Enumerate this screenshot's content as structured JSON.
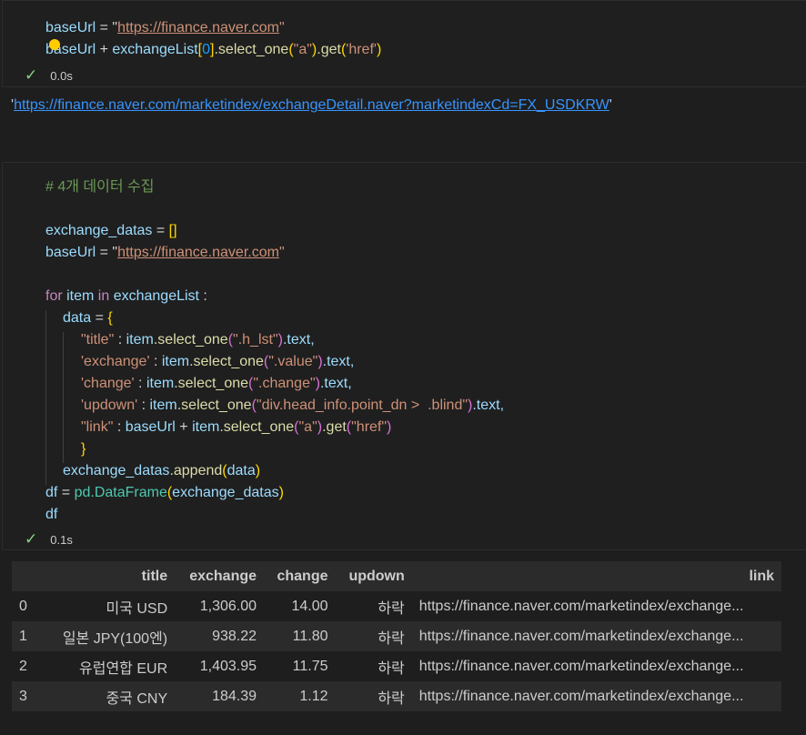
{
  "cell1": {
    "line1": {
      "var": "baseUrl",
      "op": " = \"",
      "url": "https://finance.naver.com",
      "close": "\""
    },
    "line2": {
      "var": "baseUrl",
      "op": " + ",
      "list": "exchangeList",
      "br1": "[",
      "idx": "0",
      "br2": "]",
      "call1": ".select_one",
      "p1": "(",
      "arg1": "\"a\"",
      "p2": ")",
      "call2": ".get",
      "p3": "(",
      "arg2": "'href'",
      "p4": ")"
    },
    "status_time": "0.0s"
  },
  "output1": {
    "quote_open": "'",
    "url": "https://finance.naver.com/marketindex/exchangeDetail.naver?marketindexCd=FX_USDKRW",
    "quote_close": "'"
  },
  "cell2": {
    "comment": "# 4개 데이터 수집",
    "l_datas": "exchange_datas",
    "l_datas_eq": " = ",
    "l_datas_val": "[]",
    "l_base": "baseUrl",
    "l_base_eq": " = \"",
    "l_base_url": "https://finance.naver.com",
    "l_base_close": "\"",
    "for_kw": "for",
    "for_item": " item ",
    "in_kw": "in",
    "for_list": " exchangeList",
    "for_colon": " :",
    "data_var": "data",
    "data_eq": " = ",
    "data_brace": "{",
    "rows": [
      {
        "key": "\"title\"",
        "sep": " : ",
        "obj": "item",
        "fn": ".select_one",
        "p1": "(",
        "arg": "\".h_lst\"",
        "p2": ")",
        "tail": ".text,"
      },
      {
        "key": "'exchange'",
        "sep": " : ",
        "obj": "item",
        "fn": ".select_one",
        "p1": "(",
        "arg": "\".value\"",
        "p2": ")",
        "tail": ".text,"
      },
      {
        "key": "'change'",
        "sep": " : ",
        "obj": "item",
        "fn": ".select_one",
        "p1": "(",
        "arg": "\".change\"",
        "p2": ")",
        "tail": ".text,"
      },
      {
        "key": "'updown'",
        "sep": " : ",
        "obj": "item",
        "fn": ".select_one",
        "p1": "(",
        "arg": "\"div.head_info.point_dn >  .blind\"",
        "p2": ")",
        "tail": ".text,"
      }
    ],
    "link_row": {
      "key": "\"link\"",
      "sep": " : ",
      "base": "baseUrl",
      "plus": " + ",
      "obj": "item",
      "fn": ".select_one",
      "p1": "(",
      "arg": "\"a\"",
      "p2": ")",
      "fn2": ".get",
      "p3": "(",
      "arg2": "\"href\"",
      "p4": ")"
    },
    "close_brace": "}",
    "append_obj": "exchange_datas",
    "append_fn": ".append",
    "append_p1": "(",
    "append_arg": "data",
    "append_p2": ")",
    "df_var": "df",
    "df_eq": " = ",
    "df_mod": "pd",
    "df_cls": ".DataFrame",
    "df_p1": "(",
    "df_arg": "exchange_datas",
    "df_p2": ")",
    "df_show": "df",
    "status_time": "0.1s"
  },
  "dataframe": {
    "columns": [
      "",
      "title",
      "exchange",
      "change",
      "updown",
      "link"
    ],
    "rows": [
      [
        "0",
        "미국 USD",
        "1,306.00",
        "14.00",
        "하락",
        "https://finance.naver.com/marketindex/exchange..."
      ],
      [
        "1",
        "일본 JPY(100엔)",
        "938.22",
        "11.80",
        "하락",
        "https://finance.naver.com/marketindex/exchange..."
      ],
      [
        "2",
        "유럽연합 EUR",
        "1,403.95",
        "11.75",
        "하락",
        "https://finance.naver.com/marketindex/exchange..."
      ],
      [
        "3",
        "중국 CNY",
        "184.39",
        "1.12",
        "하락",
        "https://finance.naver.com/marketindex/exchange..."
      ]
    ]
  },
  "icons": {
    "check": "check-icon",
    "bulb": "lightbulb-icon"
  }
}
